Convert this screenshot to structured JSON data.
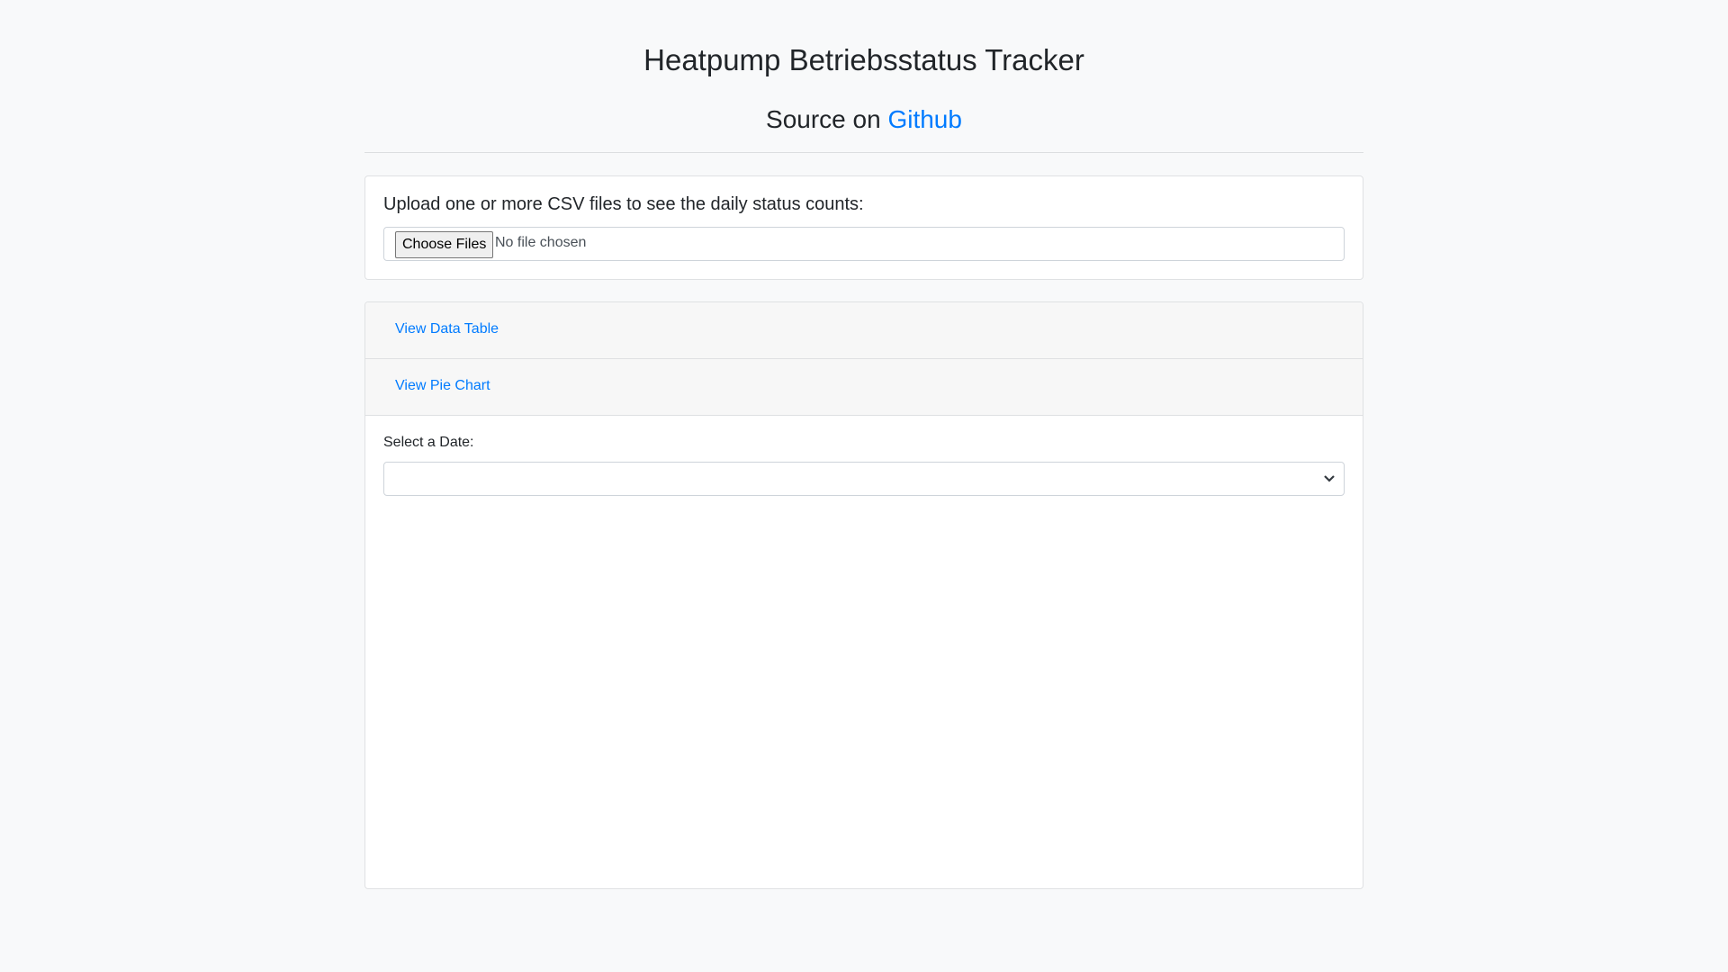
{
  "header": {
    "title": "Heatpump Betriebsstatus Tracker",
    "source_prefix": "Source on",
    "source_link": "Github"
  },
  "upload": {
    "heading": "Upload one or more CSV files to see the daily status counts:",
    "button": "Choose Files",
    "status": "No file chosen"
  },
  "accordion": {
    "items": [
      {
        "label": "View Data Table"
      },
      {
        "label": "View Pie Chart"
      }
    ]
  },
  "date_select": {
    "label": "Select a Date:",
    "value": ""
  },
  "colors": {
    "link": "#007bff",
    "background": "#f8f9fa"
  }
}
